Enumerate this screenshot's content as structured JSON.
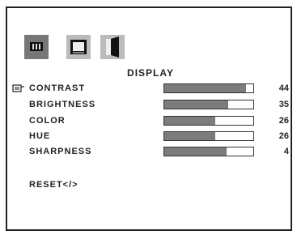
{
  "menu": {
    "title": "DISPLAY",
    "tabs": [
      {
        "icon": "display-settings-icon",
        "active": true
      },
      {
        "icon": "monitor-icon",
        "active": false
      },
      {
        "icon": "audio-speaker-icon",
        "active": false
      }
    ],
    "items": [
      {
        "label": "CONTRAST",
        "value": "44",
        "level": 0.92
      },
      {
        "label": "BRIGHTNESS",
        "value": "35",
        "level": 0.72
      },
      {
        "label": "COLOR",
        "value": "26",
        "level": 0.57
      },
      {
        "label": "HUE",
        "value": "26",
        "level": 0.57
      },
      {
        "label": "SHARPNESS",
        "value": "4",
        "level": 0.7
      }
    ],
    "reset_label": "RESET</>",
    "cursor_icon": "pointing-hand-icon"
  },
  "colors": {
    "bar_fill": "#7c7c7c",
    "active_tab": "#777777",
    "inactive_tab": "#bbbbbb"
  }
}
